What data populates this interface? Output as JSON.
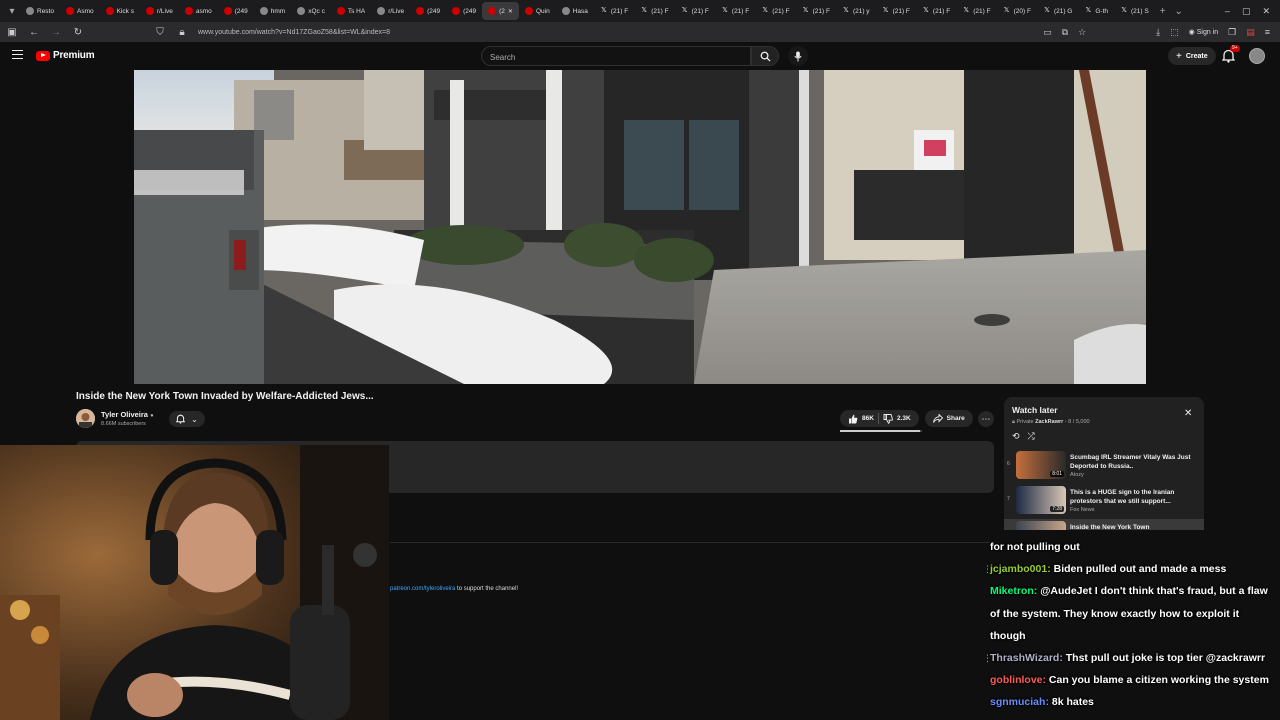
{
  "browser": {
    "tabs": [
      {
        "label": "Resto",
        "icon": "generic"
      },
      {
        "label": "Asmo",
        "icon": "youtube"
      },
      {
        "label": "Kick s",
        "icon": "youtube"
      },
      {
        "label": "r/Live",
        "icon": "youtube"
      },
      {
        "label": "asmo",
        "icon": "youtube"
      },
      {
        "label": "(249",
        "icon": "youtube"
      },
      {
        "label": "hmm",
        "icon": "generic"
      },
      {
        "label": "xQc c",
        "icon": "generic"
      },
      {
        "label": "Ts HA",
        "icon": "youtube"
      },
      {
        "label": "r/Live",
        "icon": "generic"
      },
      {
        "label": "(249",
        "icon": "youtube"
      },
      {
        "label": "(249",
        "icon": "youtube"
      },
      {
        "label": "(2",
        "icon": "youtube",
        "active": true
      },
      {
        "label": "Quin",
        "icon": "youtube"
      },
      {
        "label": "Hasa",
        "icon": "generic"
      },
      {
        "label": "(21) F",
        "icon": "x"
      },
      {
        "label": "(21) F",
        "icon": "x"
      },
      {
        "label": "(21) F",
        "icon": "x"
      },
      {
        "label": "(21) F",
        "icon": "x"
      },
      {
        "label": "(21) F",
        "icon": "x"
      },
      {
        "label": "(21) F",
        "icon": "x"
      },
      {
        "label": "(21) y",
        "icon": "x"
      },
      {
        "label": "(21) F",
        "icon": "x"
      },
      {
        "label": "(21) F",
        "icon": "x"
      },
      {
        "label": "(21) F",
        "icon": "x"
      },
      {
        "label": "(20) F",
        "icon": "x"
      },
      {
        "label": "(21) G",
        "icon": "x"
      },
      {
        "label": "G-th",
        "icon": "x"
      },
      {
        "label": "(21) S",
        "icon": "x"
      }
    ],
    "url": "www.youtube.com/watch?v=Nd17ZGaoZ58&list=WL&index=8",
    "signin_label": "Sign in"
  },
  "youtube": {
    "logo_text": "Premium",
    "search_placeholder": "Search",
    "create_label": "Create",
    "notif_badge": "9+"
  },
  "video": {
    "title": "Inside the New York Town Invaded by Welfare-Addicted Jews...",
    "channel": "Tyler Oliveira",
    "subscribers": "8.66M subscribers",
    "likes": "86K",
    "dislikes": "2.3K",
    "share_label": "Share"
  },
  "description": {
    "link_text": "patreon.com/tyleroliveira",
    "suffix": " to support the channel!"
  },
  "watch_later": {
    "title": "Watch later",
    "visibility": "Private",
    "owner": "ZackRawrr",
    "position": "8 / 5,000",
    "items": [
      {
        "index": "6",
        "title": "Scumbag IRL Streamer Vitaly Was Just Deported to Russia..",
        "channel": "Atozy",
        "duration": "8:01",
        "current": false
      },
      {
        "index": "7",
        "title": "This is a HUGE sign to the Iranian protestors that we still support...",
        "channel": "Fox News",
        "duration": "7:28",
        "current": false
      },
      {
        "index": "",
        "title": "Inside the New York Town",
        "channel": "Invaded by Welfare-Addicted...",
        "duration": "",
        "current": true
      }
    ]
  },
  "chat": {
    "messages": [
      {
        "user": "",
        "user_color": "#ffffff",
        "text": "for not pulling out",
        "has_dots": false
      },
      {
        "user": "jcjambo001",
        "user_color": "#9acd32",
        "text": "Biden pulled out and made a mess",
        "has_dots": true
      },
      {
        "user": "Miketron",
        "user_color": "#00ff7f",
        "text": "@AudeJet I don't think that's fraud, but a flaw",
        "has_dots": false
      },
      {
        "user": "",
        "user_color": "#ffffff",
        "text": "of the system. They know exactly how to exploit it",
        "has_dots": false
      },
      {
        "user": "",
        "user_color": "#ffffff",
        "text": "though",
        "has_dots": false
      },
      {
        "user": "ThrashWizard",
        "user_color": "#b0b0c8",
        "text": "Thst pull out joke is top tier @zackrawrr",
        "has_dots": true
      },
      {
        "user": "goblinlove",
        "user_color": "#ff5a5a",
        "text": "Can you blame a citizen working the system",
        "has_dots": false
      },
      {
        "user": "sgnmuciah",
        "user_color": "#6a8cff",
        "text": "8k hates",
        "has_dots": false
      }
    ]
  },
  "colors": {
    "youtube_red": "#ff0000",
    "link_blue": "#3ea6ff",
    "panel_bg": "#212121",
    "pill_bg": "#272727"
  }
}
